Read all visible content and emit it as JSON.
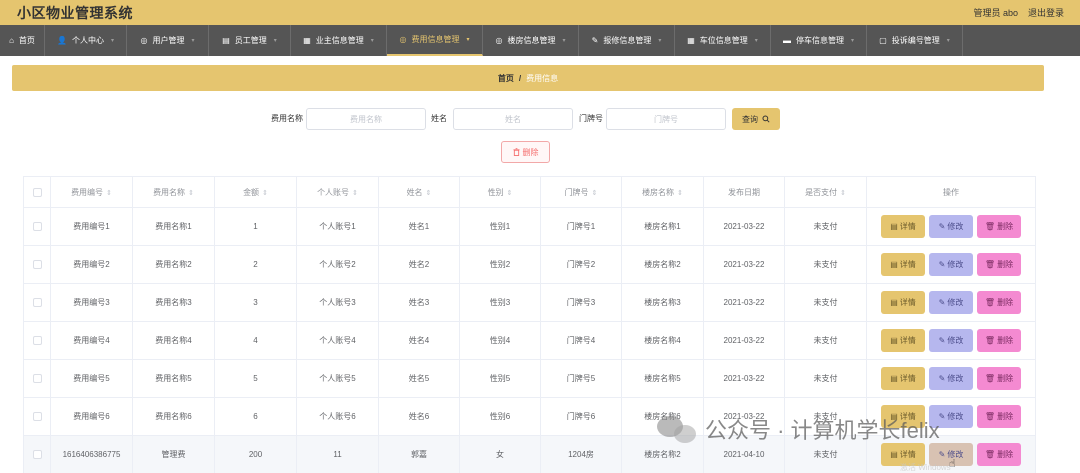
{
  "app": {
    "title": "小区物业管理系统",
    "user_label": "管理员 abo",
    "logout_label": "退出登录"
  },
  "nav": [
    {
      "label": "首页",
      "icon": "home-icon",
      "glyph": "⌂",
      "dropdown": false,
      "active": false
    },
    {
      "label": "个人中心",
      "icon": "user-icon",
      "glyph": "👤",
      "dropdown": true,
      "active": false
    },
    {
      "label": "用户管理",
      "icon": "users-icon",
      "glyph": "◎",
      "dropdown": true,
      "active": false
    },
    {
      "label": "员工管理",
      "icon": "staff-icon",
      "glyph": "▤",
      "dropdown": true,
      "active": false
    },
    {
      "label": "业主信息管理",
      "icon": "owner-icon",
      "glyph": "▦",
      "dropdown": true,
      "active": false
    },
    {
      "label": "费用信息管理",
      "icon": "fee-icon",
      "glyph": "◎",
      "dropdown": true,
      "active": true
    },
    {
      "label": "楼房信息管理",
      "icon": "building-icon",
      "glyph": "◎",
      "dropdown": true,
      "active": false
    },
    {
      "label": "报修信息管理",
      "icon": "repair-icon",
      "glyph": "✎",
      "dropdown": true,
      "active": false
    },
    {
      "label": "车位信息管理",
      "icon": "parking-icon",
      "glyph": "▦",
      "dropdown": true,
      "active": false
    },
    {
      "label": "停车信息管理",
      "icon": "car-icon",
      "glyph": "▬",
      "dropdown": true,
      "active": false
    },
    {
      "label": "投诉编号管理",
      "icon": "complaint-icon",
      "glyph": "▢",
      "dropdown": true,
      "active": false
    }
  ],
  "breadcrumb": {
    "home": "首页",
    "separator": "/",
    "current": "费用信息"
  },
  "search": {
    "fee_name_label": "费用名称",
    "fee_name_placeholder": "费用名称",
    "name_label": "姓名",
    "name_placeholder": "姓名",
    "door_label": "门牌号",
    "door_placeholder": "门牌号",
    "button_label": "查询"
  },
  "batch_delete_label": "删除",
  "table": {
    "columns": [
      "费用编号",
      "费用名称",
      "金额",
      "个人账号",
      "姓名",
      "性别",
      "门牌号",
      "楼房名称",
      "发布日期",
      "是否支付",
      "操作"
    ],
    "sortable": [
      true,
      true,
      true,
      true,
      true,
      true,
      true,
      true,
      false,
      true,
      false
    ],
    "rows": [
      [
        "费用编号1",
        "费用名称1",
        "1",
        "个人账号1",
        "姓名1",
        "性别1",
        "门牌号1",
        "楼房名称1",
        "2021-03-22",
        "未支付"
      ],
      [
        "费用编号2",
        "费用名称2",
        "2",
        "个人账号2",
        "姓名2",
        "性别2",
        "门牌号2",
        "楼房名称2",
        "2021-03-22",
        "未支付"
      ],
      [
        "费用编号3",
        "费用名称3",
        "3",
        "个人账号3",
        "姓名3",
        "性别3",
        "门牌号3",
        "楼房名称3",
        "2021-03-22",
        "未支付"
      ],
      [
        "费用编号4",
        "费用名称4",
        "4",
        "个人账号4",
        "姓名4",
        "性别4",
        "门牌号4",
        "楼房名称4",
        "2021-03-22",
        "未支付"
      ],
      [
        "费用编号5",
        "费用名称5",
        "5",
        "个人账号5",
        "姓名5",
        "性别5",
        "门牌号5",
        "楼房名称5",
        "2021-03-22",
        "未支付"
      ],
      [
        "费用编号6",
        "费用名称6",
        "6",
        "个人账号6",
        "姓名6",
        "性别6",
        "门牌号6",
        "楼房名称6",
        "2021-03-22",
        "未支付"
      ],
      [
        "1616406386775",
        "管理费",
        "200",
        "11",
        "郭嘉",
        "女",
        "1204房",
        "楼房名称2",
        "2021-04-10",
        "未支付"
      ]
    ],
    "actions": {
      "detail": "详情",
      "edit": "修改",
      "delete": "删除"
    }
  },
  "overlay": {
    "watermark_text": "公众号 · 计算机学长felix",
    "windows_text": "激活 Windows"
  },
  "colors": {
    "accent": "#e5c56f",
    "nav_bg": "#555555",
    "edit": "#b6b7ee",
    "delete": "#f48ad1"
  }
}
